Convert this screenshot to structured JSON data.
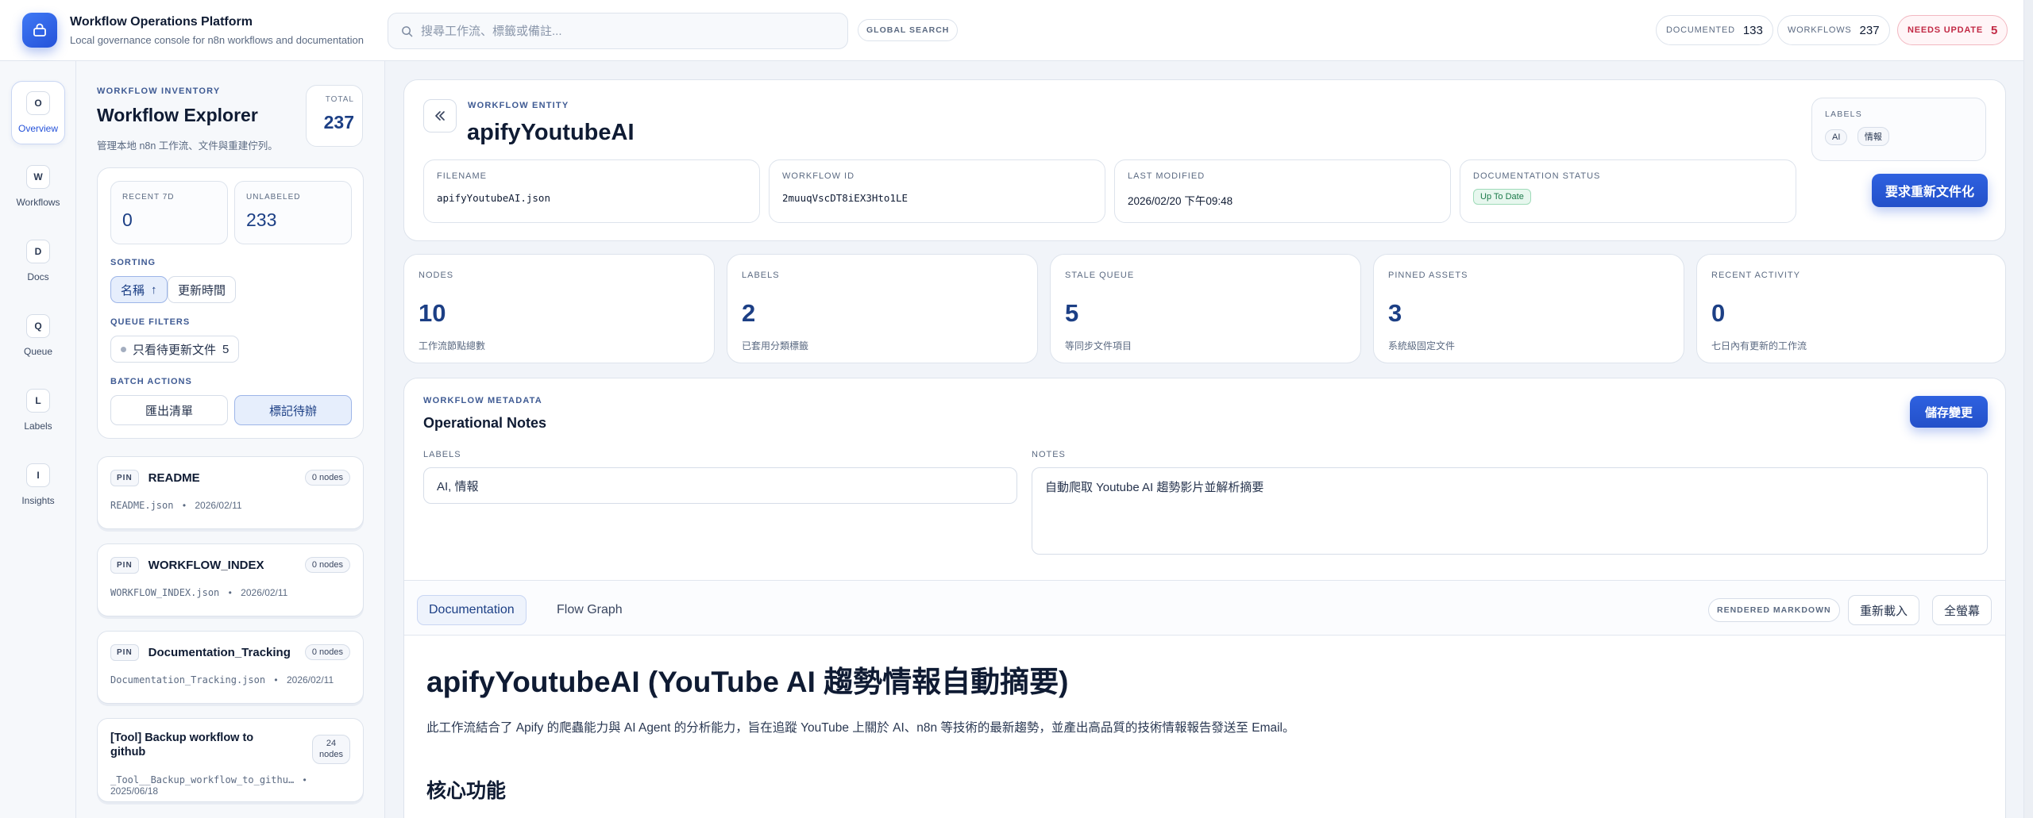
{
  "app": {
    "title": "Workflow Operations Platform",
    "subtitle": "Local governance console for n8n workflows and documentation"
  },
  "search": {
    "placeholder": "搜尋工作流、標籤或備註...",
    "global_label": "GLOBAL SEARCH"
  },
  "header_stats": [
    {
      "label": "DOCUMENTED",
      "value": "133"
    },
    {
      "label": "WORKFLOWS",
      "value": "237"
    },
    {
      "label": "NEEDS UPDATE",
      "value": "5"
    }
  ],
  "rail": [
    {
      "badge": "O",
      "label": "Overview",
      "icon": "overview-icon"
    },
    {
      "badge": "W",
      "label": "Workflows",
      "icon": "workflows-icon"
    },
    {
      "badge": "D",
      "label": "Docs",
      "icon": "docs-icon"
    },
    {
      "badge": "Q",
      "label": "Queue",
      "icon": "queue-icon"
    },
    {
      "badge": "L",
      "label": "Labels",
      "icon": "labels-icon"
    },
    {
      "badge": "I",
      "label": "Insights",
      "icon": "insights-icon"
    }
  ],
  "sidebar": {
    "eyebrow": "WORKFLOW INVENTORY",
    "title": "Workflow Explorer",
    "subtitle": "管理本地 n8n 工作流、文件與重建佇列。",
    "total_label": "TOTAL",
    "total_value": "237",
    "recent_label": "RECENT 7D",
    "recent_value": "0",
    "unlabeled_label": "UNLABELED",
    "unlabeled_value": "233",
    "sorting_label": "SORTING",
    "sort_name": "名稱",
    "sort_name_arrow": "↑",
    "sort_time": "更新時間",
    "queue_filters_label": "QUEUE FILTERS",
    "filter_pending": "只看待更新文件",
    "filter_pending_count": "5",
    "batch_label": "BATCH ACTIONS",
    "export_btn": "匯出清單",
    "mark_btn": "標記待辦"
  },
  "workflow_list": [
    {
      "pin": "PIN",
      "name": "README",
      "nodes": "0 nodes",
      "file": "README.json",
      "date": "2026/02/11"
    },
    {
      "pin": "PIN",
      "name": "WORKFLOW_INDEX",
      "nodes": "0 nodes",
      "file": "WORKFLOW_INDEX.json",
      "date": "2026/02/11"
    },
    {
      "pin": "PIN",
      "name": "Documentation_Tracking",
      "nodes": "0 nodes",
      "file": "Documentation_Tracking.json",
      "date": "2026/02/11"
    },
    {
      "name_line1": "[Tool] Backup workflow to",
      "name_line2": "github",
      "nodes_line1": "24",
      "nodes_line2": "nodes",
      "file": "_Tool__Backup_workflow_to_githu…",
      "date": "2025/06/18"
    }
  ],
  "entity": {
    "eyebrow": "WORKFLOW ENTITY",
    "title": "apifyYoutubeAI",
    "filename_label": "FILENAME",
    "filename": "apifyYoutubeAI.json",
    "id_label": "WORKFLOW ID",
    "id": "2muuqVscDT8iEX3Hto1LE",
    "modified_label": "LAST MODIFIED",
    "modified": "2026/02/20 下午09:48",
    "status_label": "DOCUMENTATION STATUS",
    "status": "Up To Date",
    "labels_label": "LABELS",
    "labels": [
      "AI",
      "情報"
    ],
    "redoc_btn": "要求重新文件化"
  },
  "metrics": [
    {
      "label": "NODES",
      "value": "10",
      "sub": "工作流節點總數"
    },
    {
      "label": "LABELS",
      "value": "2",
      "sub": "已套用分類標籤"
    },
    {
      "label": "STALE QUEUE",
      "value": "5",
      "sub": "等同步文件項目"
    },
    {
      "label": "PINNED ASSETS",
      "value": "3",
      "sub": "系統級固定文件"
    },
    {
      "label": "RECENT ACTIVITY",
      "value": "0",
      "sub": "七日內有更新的工作流"
    }
  ],
  "metadata": {
    "eyebrow": "WORKFLOW METADATA",
    "title": "Operational Notes",
    "save_btn": "儲存變更",
    "labels_label": "LABELS",
    "labels_value": "AI, 情報",
    "notes_label": "NOTES",
    "notes_value": "自動爬取 Youtube AI 趨勢影片並解析摘要"
  },
  "tabs": {
    "documentation": "Documentation",
    "flow_graph": "Flow Graph",
    "rendered": "RENDERED MARKDOWN",
    "reload": "重新載入",
    "fullscreen": "全螢幕"
  },
  "doc": {
    "h1": "apifyYoutubeAI (YouTube AI 趨勢情報自動摘要)",
    "p": "此工作流結合了 Apify 的爬蟲能力與 AI Agent 的分析能力，旨在追蹤 YouTube 上關於 AI、n8n 等技術的最新趨勢，並產出高品質的技術情報報告發送至 Email。",
    "h2": "核心功能"
  },
  "colors": {
    "accent": "#2552d9",
    "warn": "#c22a45",
    "ok": "#1b7a49"
  }
}
